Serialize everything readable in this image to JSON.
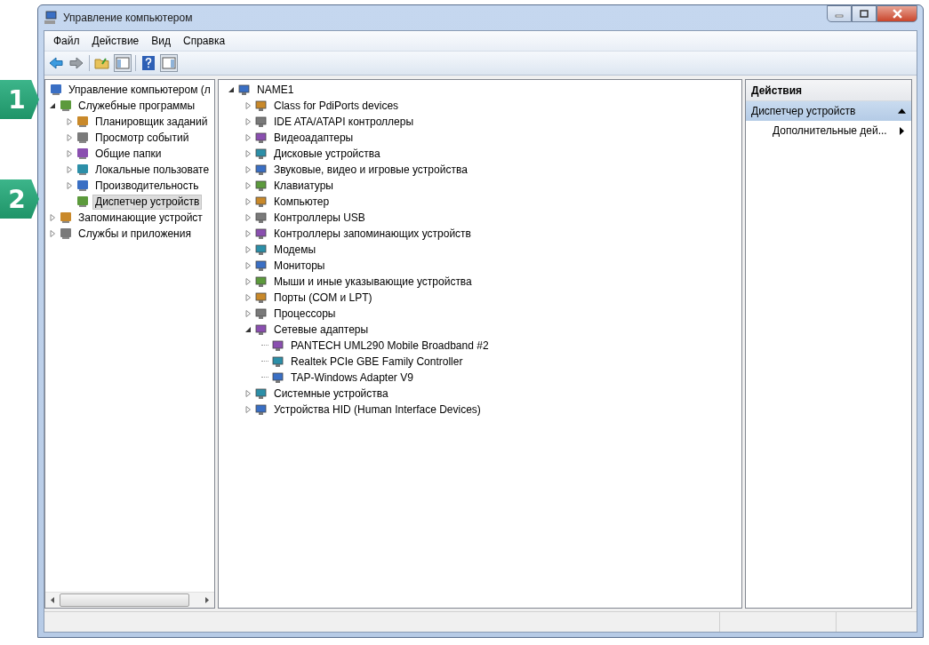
{
  "window": {
    "title": "Управление компьютером"
  },
  "menu": [
    {
      "label": "Файл"
    },
    {
      "label": "Действие"
    },
    {
      "label": "Вид"
    },
    {
      "label": "Справка"
    }
  ],
  "left_tree": [
    {
      "label": "Управление компьютером (л",
      "selected": false,
      "children": [
        {
          "label": "Служебные программы",
          "selected": false,
          "expanded": true,
          "children": [
            {
              "label": "Планировщик заданий",
              "selected": false,
              "expanded": false
            },
            {
              "label": "Просмотр событий",
              "selected": false,
              "expanded": false
            },
            {
              "label": "Общие папки",
              "selected": false,
              "expanded": false
            },
            {
              "label": "Локальные пользовате",
              "selected": false,
              "expanded": false
            },
            {
              "label": "Производительность",
              "selected": false,
              "expanded": false
            },
            {
              "label": "Диспетчер устройств",
              "selected": true
            }
          ]
        },
        {
          "label": "Запоминающие устройст",
          "selected": false,
          "expanded": false
        },
        {
          "label": "Службы и приложения",
          "selected": false,
          "expanded": false
        }
      ]
    }
  ],
  "device_tree": [
    {
      "label": "NAME1",
      "expanded": true,
      "children": [
        {
          "label": "Class for PdiPorts devices",
          "expanded": false
        },
        {
          "label": "IDE ATA/ATAPI контроллеры",
          "expanded": false
        },
        {
          "label": "Видеоадаптеры",
          "expanded": false
        },
        {
          "label": "Дисковые устройства",
          "expanded": false
        },
        {
          "label": "Звуковые, видео и игровые устройства",
          "expanded": false
        },
        {
          "label": "Клавиатуры",
          "expanded": false
        },
        {
          "label": "Компьютер",
          "expanded": false
        },
        {
          "label": "Контроллеры USB",
          "expanded": false
        },
        {
          "label": "Контроллеры запоминающих устройств",
          "expanded": false
        },
        {
          "label": "Модемы",
          "expanded": false
        },
        {
          "label": "Мониторы",
          "expanded": false
        },
        {
          "label": "Мыши и иные указывающие устройства",
          "expanded": false
        },
        {
          "label": "Порты (COM и LPT)",
          "expanded": false
        },
        {
          "label": "Процессоры",
          "expanded": false
        },
        {
          "label": "Сетевые адаптеры",
          "expanded": true,
          "children": [
            {
              "label": "PANTECH UML290 Mobile Broadband #2"
            },
            {
              "label": "Realtek PCIe GBE Family Controller"
            },
            {
              "label": "TAP-Windows Adapter V9"
            }
          ]
        },
        {
          "label": "Системные устройства",
          "expanded": false
        },
        {
          "label": "Устройства HID (Human Interface Devices)",
          "expanded": false
        }
      ]
    }
  ],
  "actions": {
    "title": "Действия",
    "section": {
      "label": "Диспетчер устройств",
      "expanded": true
    },
    "items": [
      {
        "label": "Дополнительные дей..."
      }
    ]
  },
  "callouts": [
    {
      "label": "1"
    },
    {
      "label": "2"
    }
  ]
}
